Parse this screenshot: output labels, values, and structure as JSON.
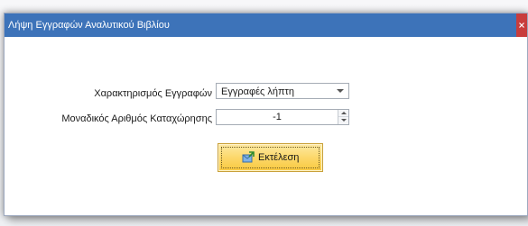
{
  "window": {
    "title": "Λήψη Εγγραφών Αναλυτικού Βιβλίου",
    "close_glyph": "×"
  },
  "form": {
    "doc_type_label": "Χαρακτηρισμός Εγγραφών",
    "doc_type_value": "Εγγραφές λήπτη",
    "reg_no_label": "Μοναδικός Αριθμός Καταχώρησης",
    "reg_no_value": "-1"
  },
  "actions": {
    "execute_label": "Εκτέλεση",
    "execute_icon": "execute-icon"
  },
  "colors": {
    "titlebar": "#3d73b9",
    "close": "#c83c3c",
    "button_gradient_top": "#fde9a4",
    "button_gradient_bottom": "#f9c83d"
  }
}
